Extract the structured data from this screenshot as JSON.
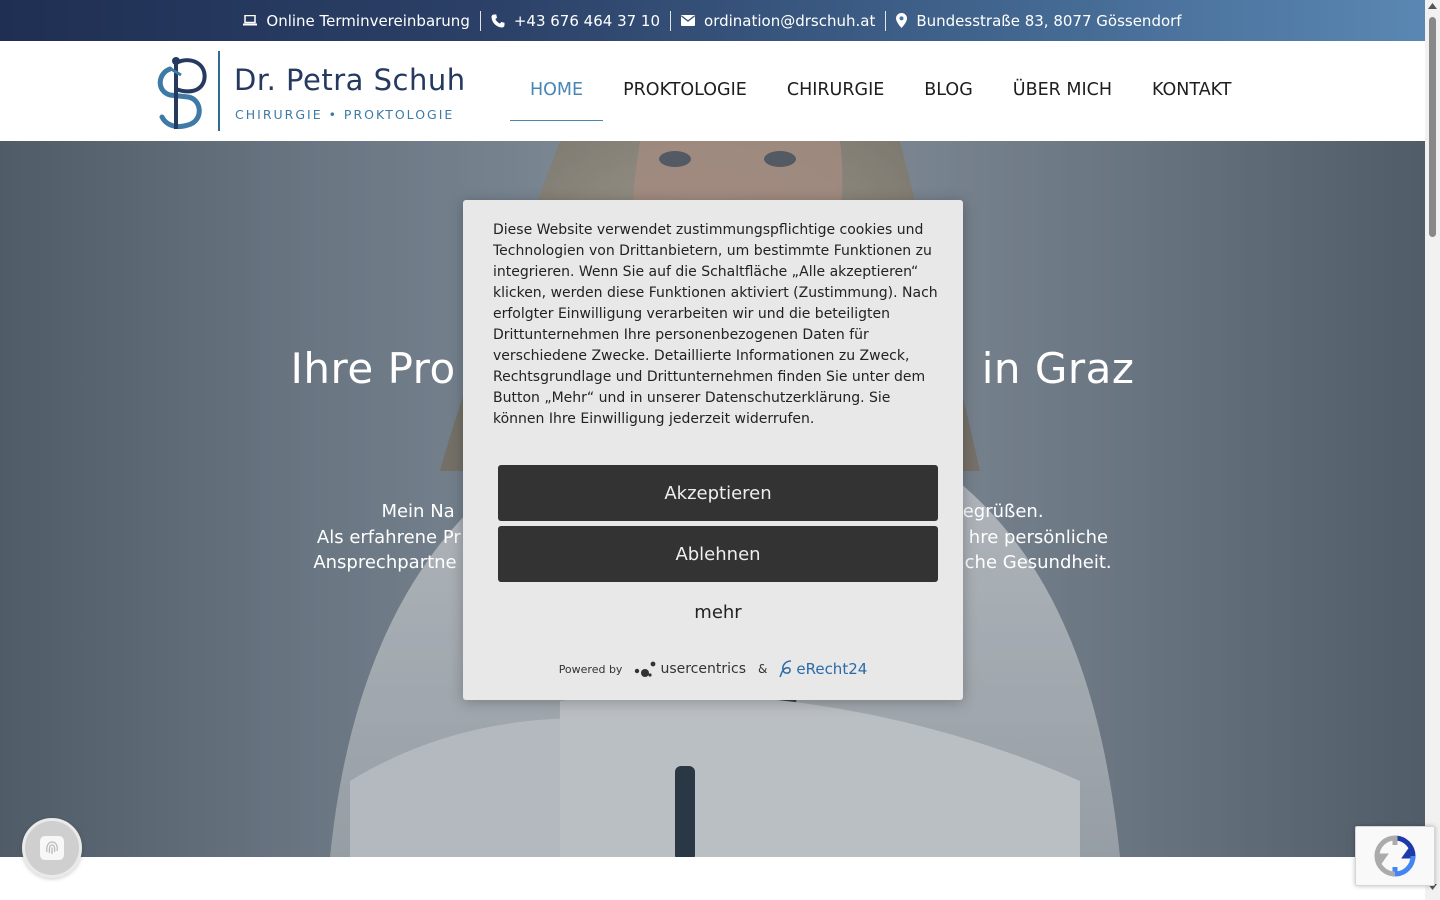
{
  "topbar": {
    "booking_label": "Online Terminvereinbarung",
    "phone": "+43 676 464 37 10",
    "email": "ordination@drschuh.at",
    "address": "Bundesstraße 83, 8077 Gössendorf",
    "icons": [
      "laptop-icon",
      "phone-icon",
      "envelope-icon",
      "map-pin-icon"
    ]
  },
  "logo": {
    "name": "Dr. Petra Schuh",
    "tagline": "CHIRURGIE • PROKTOLOGIE"
  },
  "nav": {
    "items": [
      "HOME",
      "PROKTOLOGIE",
      "CHIRURGIE",
      "BLOG",
      "ÜBER MICH",
      "KONTAKT"
    ],
    "active": "HOME"
  },
  "hero": {
    "title_left": "Ihre Pro",
    "title_right": "in Graz",
    "intro_lines_left": [
      "Mein Na",
      "Als erfahrene Pr",
      "Ansprechpartne"
    ],
    "intro_lines_right": [
      "egrüßen.",
      "hre persönliche",
      "che Gesundheit."
    ]
  },
  "consent": {
    "text": "Diese Website verwendet zustimmungspflichtige cookies und Technologien von Drittanbietern, um bestimmte Funktionen zu integrieren. Wenn Sie auf die Schaltfläche „Alle akzeptieren“ klicken, werden diese Funktionen aktiviert (Zustimmung). Nach erfolgter Einwilligung verarbeiten wir und die beteiligten Drittunternehmen Ihre personenbezogenen Daten für verschiedene Zwecke. Detaillierte Informationen zu Zweck, Rechtsgrundlage und Drittunternehmen finden Sie unter dem Button „Mehr“ und in unserer Datenschutzerklärung. Sie können Ihre Einwilligung jederzeit widerrufen.",
    "accept_label": "Akzeptieren",
    "decline_label": "Ablehnen",
    "more_label": "mehr",
    "powered_by": "Powered by",
    "usercentrics": "usercentrics",
    "ampersand": "&",
    "erecht": "eRecht24"
  },
  "colors": {
    "topbar_start": "#1f2f53",
    "topbar_end": "#5a87b3",
    "nav_active": "#4a86b4",
    "logo_dark": "#253a5e",
    "logo_accent": "#3f7aa6",
    "button_dark": "#333333",
    "modal_bg": "#e8e8e8"
  }
}
